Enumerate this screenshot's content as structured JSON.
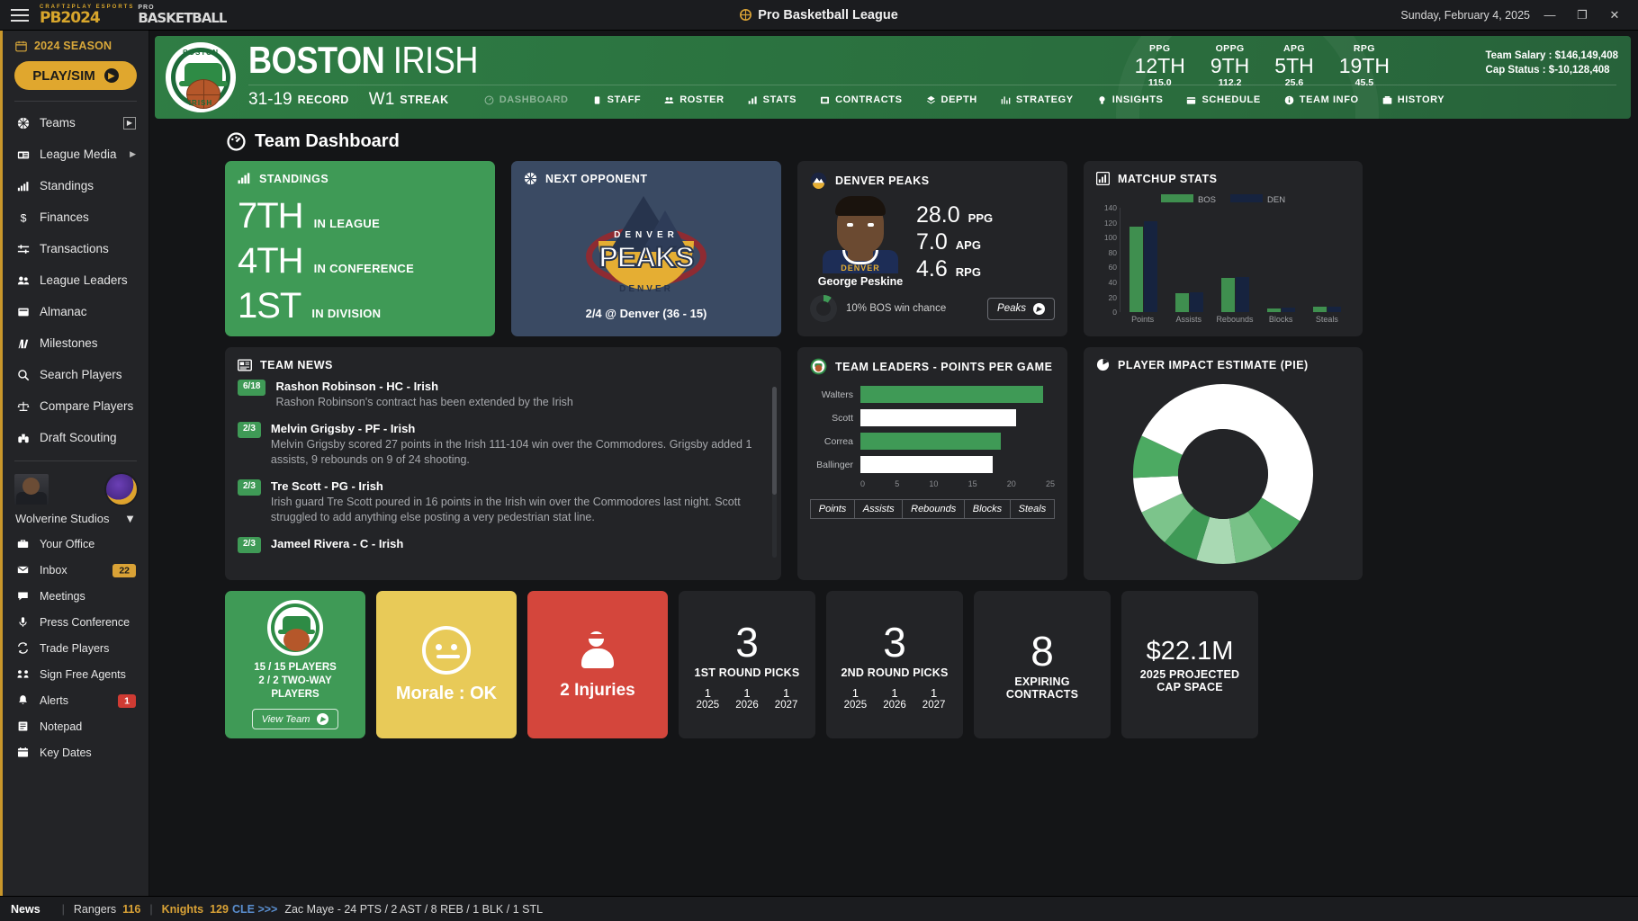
{
  "titlebar": {
    "app_title": "Pro Basketball League",
    "date": "Sunday, February 4, 2025",
    "brand_top": "CRAFT2PLAY ESPORTS",
    "brand_pb": "PB2024",
    "brand_pro": "PRO",
    "brand_bb": "BASKETBALL",
    "minimize": "—",
    "maximize": "❐",
    "close": "✕"
  },
  "sidebar": {
    "season": "2024 SEASON",
    "play_sim": "PLAY/SIM",
    "items": [
      {
        "label": "Teams",
        "icon": "basketball-icon",
        "trailing": "box-caret"
      },
      {
        "label": "League Media",
        "icon": "news-icon",
        "trailing": "caret"
      },
      {
        "label": "Standings",
        "icon": "bars-icon",
        "trailing": ""
      },
      {
        "label": "Finances",
        "icon": "dollar-icon",
        "trailing": ""
      },
      {
        "label": "Transactions",
        "icon": "exchange-icon",
        "trailing": ""
      },
      {
        "label": "League Leaders",
        "icon": "people-icon",
        "trailing": ""
      },
      {
        "label": "Almanac",
        "icon": "book-icon",
        "trailing": ""
      },
      {
        "label": "Milestones",
        "icon": "milestone-icon",
        "trailing": ""
      },
      {
        "label": "Search Players",
        "icon": "search-icon",
        "trailing": ""
      },
      {
        "label": "Compare Players",
        "icon": "scales-icon",
        "trailing": ""
      },
      {
        "label": "Draft Scouting",
        "icon": "binoculars-icon",
        "trailing": ""
      }
    ],
    "studio": "Wolverine Studios",
    "office_items": [
      {
        "label": "Your Office",
        "icon": "briefcase-icon",
        "badge": "",
        "badge_color": ""
      },
      {
        "label": "Inbox",
        "icon": "envelope-icon",
        "badge": "22",
        "badge_color": "#d9a236"
      },
      {
        "label": "Meetings",
        "icon": "chat-icon",
        "badge": "",
        "badge_color": ""
      },
      {
        "label": "Press Conference",
        "icon": "microphone-icon",
        "badge": "",
        "badge_color": ""
      },
      {
        "label": "Trade Players",
        "icon": "refresh-icon",
        "badge": "",
        "badge_color": ""
      },
      {
        "label": "Sign Free Agents",
        "icon": "handshake-icon",
        "badge": "",
        "badge_color": ""
      },
      {
        "label": "Alerts",
        "icon": "bell-icon",
        "badge": "1",
        "badge_color": "#cf3b33"
      },
      {
        "label": "Notepad",
        "icon": "notepad-icon",
        "badge": "",
        "badge_color": ""
      },
      {
        "label": "Key Dates",
        "icon": "calendar-icon",
        "badge": "",
        "badge_color": ""
      }
    ]
  },
  "team_header": {
    "city": "BOSTON",
    "nickname": "IRISH",
    "logo_top": "BOSTON",
    "logo_bottom": "IRISH",
    "record_value": "31-19",
    "record_label": "RECORD",
    "streak_value": "W1",
    "streak_label": "STREAK",
    "tabs": [
      {
        "label": "DASHBOARD",
        "icon": "dashboard-icon",
        "active": true
      },
      {
        "label": "STAFF",
        "icon": "staff-icon",
        "active": false
      },
      {
        "label": "ROSTER",
        "icon": "roster-icon",
        "active": false
      },
      {
        "label": "STATS",
        "icon": "stats-icon",
        "active": false
      },
      {
        "label": "CONTRACTS",
        "icon": "contracts-icon",
        "active": false
      },
      {
        "label": "DEPTH",
        "icon": "depth-icon",
        "active": false
      },
      {
        "label": "STRATEGY",
        "icon": "strategy-icon",
        "active": false
      },
      {
        "label": "INSIGHTS",
        "icon": "insights-icon",
        "active": false
      },
      {
        "label": "SCHEDULE",
        "icon": "schedule-icon",
        "active": false
      },
      {
        "label": "TEAM INFO",
        "icon": "info-icon",
        "active": false
      },
      {
        "label": "HISTORY",
        "icon": "history-icon",
        "active": false
      }
    ],
    "stats": [
      {
        "label": "PPG",
        "rank": "12TH",
        "value": "115.0"
      },
      {
        "label": "OPPG",
        "rank": "9TH",
        "value": "112.2"
      },
      {
        "label": "APG",
        "rank": "5TH",
        "value": "25.6"
      },
      {
        "label": "RPG",
        "rank": "19TH",
        "value": "45.5"
      }
    ],
    "team_salary": "Team Salary : $146,149,408",
    "cap_status": "Cap Status : $-10,128,408"
  },
  "dashboard": {
    "title": "Team Dashboard",
    "standings": {
      "title": "STANDINGS",
      "rows": [
        {
          "rank": "7TH",
          "label": "IN LEAGUE"
        },
        {
          "rank": "4TH",
          "label": "IN CONFERENCE"
        },
        {
          "rank": "1ST",
          "label": "IN DIVISION"
        }
      ]
    },
    "next_opponent": {
      "title": "NEXT OPPONENT",
      "logo_city": "DENVER",
      "logo_name": "PEAKS",
      "logo_sub": "DENVER",
      "game": "2/4 @ Denver (36 - 15)"
    },
    "opponent_card": {
      "title": "DENVER PEAKS",
      "player_name": "George Peskine",
      "jersey_text": "DENVER",
      "stats": [
        {
          "value": "28.0",
          "label": "PPG"
        },
        {
          "value": "7.0",
          "label": "APG"
        },
        {
          "value": "4.6",
          "label": "RPG"
        }
      ],
      "win_chance": "10% BOS win chance",
      "win_chance_pct": 10,
      "button": "Peaks"
    },
    "team_news": {
      "title": "TEAM NEWS",
      "items": [
        {
          "date": "6/18",
          "headline": "Rashon Robinson - HC - Irish",
          "body": "Rashon Robinson's contract has been extended by the Irish"
        },
        {
          "date": "2/3",
          "headline": "Melvin Grigsby - PF - Irish",
          "body": "Melvin Grigsby scored 27 points in the Irish 111-104 win over the Commodores. Grigsby added 1 assists, 9 rebounds on 9 of 24 shooting."
        },
        {
          "date": "2/3",
          "headline": "Tre Scott - PG - Irish",
          "body": "Irish guard Tre Scott poured in 16 points in the Irish win over the Commodores last night. Scott struggled to add anything else posting a very pedestrian stat line."
        },
        {
          "date": "2/3",
          "headline": "Jameel Rivera - C - Irish",
          "body": ""
        }
      ]
    },
    "team_leaders": {
      "title": "TEAM LEADERS - POINTS PER GAME",
      "buttons": [
        "Points",
        "Assists",
        "Rebounds",
        "Blocks",
        "Steals"
      ],
      "active_button": "Points"
    },
    "pie": {
      "title": "PLAYER IMPACT ESTIMATE (PIE)"
    },
    "bottom": {
      "roster": {
        "line1": "15 / 15 PLAYERS",
        "line2": "2 / 2 TWO-WAY PLAYERS",
        "button": "View Team"
      },
      "morale": "Morale : OK",
      "injuries": "2 Injuries",
      "picks": [
        {
          "count": "3",
          "caption": "1ST ROUND PICKS",
          "detail": [
            {
              "n": "1",
              "y": "2025"
            },
            {
              "n": "1",
              "y": "2026"
            },
            {
              "n": "1",
              "y": "2027"
            }
          ]
        },
        {
          "count": "3",
          "caption": "2ND ROUND PICKS",
          "detail": [
            {
              "n": "1",
              "y": "2025"
            },
            {
              "n": "1",
              "y": "2026"
            },
            {
              "n": "1",
              "y": "2027"
            }
          ]
        }
      ],
      "expiring": {
        "count": "8",
        "caption_line1": "EXPIRING",
        "caption_line2": "CONTRACTS"
      },
      "cap_space": {
        "amount": "$22.1M",
        "caption_line1": "2025 PROJECTED",
        "caption_line2": "CAP SPACE"
      }
    }
  },
  "statusbar": {
    "news_label": "News",
    "team_a": "Rangers",
    "score_a": "116",
    "team_b": "Knights",
    "score_b": "129",
    "ticker_team": "CLE >>>",
    "ticker_line": "Zac Maye - 24 PTS / 2 AST / 8 REB / 1 BLK / 1 STL"
  },
  "chart_data": [
    {
      "type": "bar",
      "title": "MATCHUP STATS",
      "categories": [
        "Points",
        "Assists",
        "Rebounds",
        "Blocks",
        "Steals"
      ],
      "series": [
        {
          "name": "BOS",
          "color": "#3f8f4f",
          "values": [
            115.0,
            25.6,
            45.5,
            5.0,
            7.2
          ]
        },
        {
          "name": "DEN",
          "color": "#16233f",
          "values": [
            122.5,
            26.3,
            47.0,
            5.4,
            7.0
          ]
        }
      ],
      "yticks": [
        0,
        20,
        40,
        60,
        80,
        100,
        120,
        140
      ],
      "ylim": [
        0,
        140
      ],
      "legend": "top-center",
      "grid": false
    },
    {
      "type": "bar",
      "orientation": "horizontal",
      "title": "TEAM LEADERS - POINTS PER GAME",
      "categories": [
        "Walters",
        "Scott",
        "Correa",
        "Ballinger"
      ],
      "values": [
        23.5,
        20.0,
        18.0,
        17.0
      ],
      "colors": [
        "#3f9a56",
        "#ffffff",
        "#3f9a56",
        "#ffffff"
      ],
      "xticks": [
        0,
        5,
        10,
        15,
        20,
        25
      ],
      "xlim": [
        0,
        25
      ],
      "grid": false
    },
    {
      "type": "pie",
      "title": "PLAYER IMPACT ESTIMATE (PIE)",
      "donut": true,
      "slices": [
        {
          "value": 26,
          "color": "#ffffff"
        },
        {
          "value": 13,
          "color": "#4caa62"
        },
        {
          "value": 9,
          "color": "#79c288"
        },
        {
          "value": 9,
          "color": "#a9d9b3"
        },
        {
          "value": 8,
          "color": "#3f9a56"
        },
        {
          "value": 8,
          "color": "#7cc48b"
        },
        {
          "value": 7,
          "color": "#ffffff"
        },
        {
          "value": 7,
          "color": "#4caa62"
        },
        {
          "value": 13,
          "color": "#ffffff"
        }
      ]
    }
  ]
}
